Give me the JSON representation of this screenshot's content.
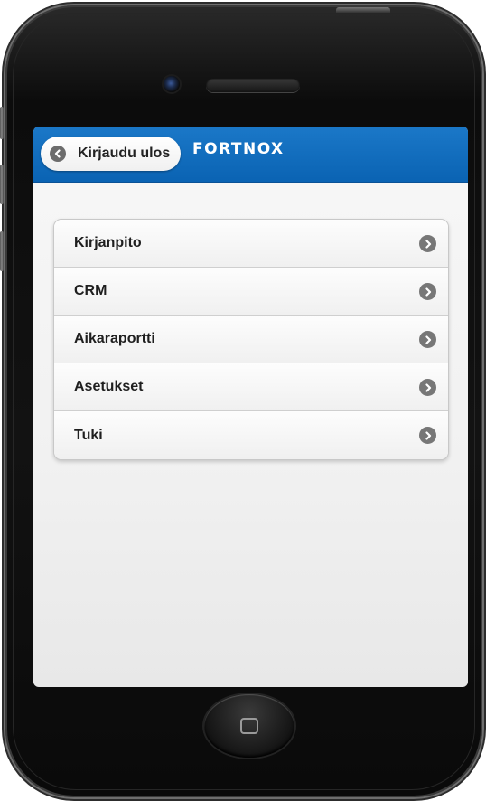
{
  "app": {
    "logo_text": "FORTNOX",
    "brand_color": "#0a63b3"
  },
  "header": {
    "back_label": "Kirjaudu ulos",
    "back_icon": "chevron-left-icon"
  },
  "menu": {
    "items": [
      {
        "label": "Kirjanpito",
        "icon": "chevron-right-icon"
      },
      {
        "label": "CRM",
        "icon": "chevron-right-icon"
      },
      {
        "label": "Aikaraportti",
        "icon": "chevron-right-icon"
      },
      {
        "label": "Asetukset",
        "icon": "chevron-right-icon"
      },
      {
        "label": "Tuki",
        "icon": "chevron-right-icon"
      }
    ]
  },
  "device": {
    "frame": "iphone",
    "home_icon": "home-button-icon"
  }
}
